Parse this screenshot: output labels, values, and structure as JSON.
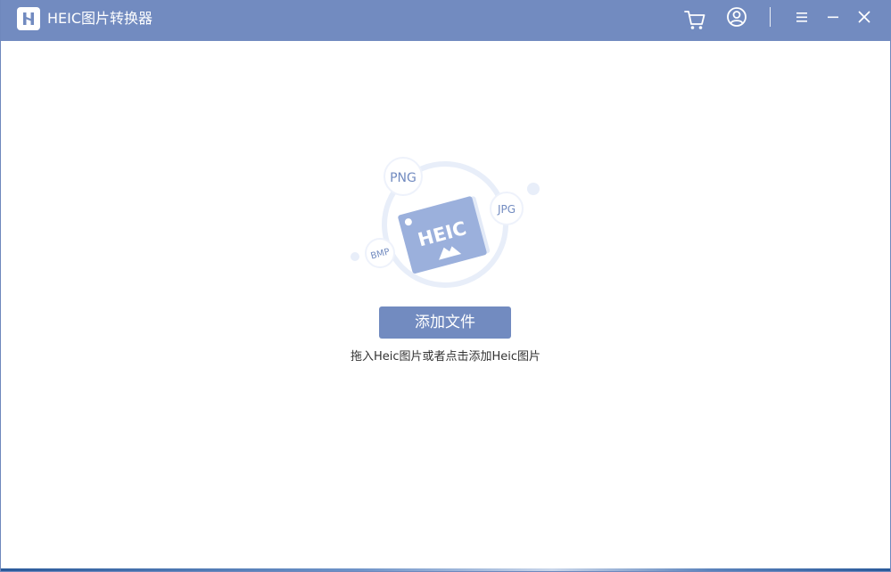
{
  "titlebar": {
    "title": "HEIC图片转换器"
  },
  "main": {
    "illustration": {
      "center_label": "HEIC",
      "badges": [
        "PNG",
        "JPG",
        "BMP"
      ]
    },
    "add_button_label": "添加文件",
    "hint": "拖入Heic图片或者点击添加Heic图片"
  },
  "colors": {
    "accent": "#728bc0",
    "illustration_light": "#e8eef9",
    "illustration_card": "#9bb0dc"
  },
  "icons": [
    "app-logo",
    "cart-icon",
    "user-icon",
    "menu-icon",
    "minimize-icon",
    "close-icon"
  ]
}
